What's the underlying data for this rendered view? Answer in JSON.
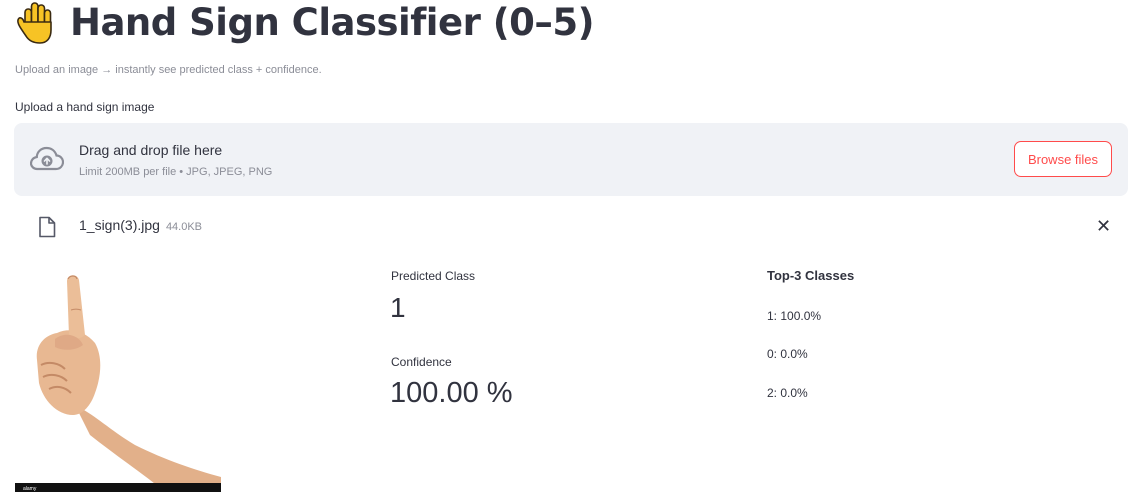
{
  "app": {
    "title": "Hand Sign Classifier (0–5)",
    "title_icon": "raised-hand-emoji",
    "subtitle": "Upload an image → instantly see predicted class + confidence."
  },
  "uploader": {
    "label": "Upload a hand sign image",
    "drop_text": "Drag and drop file here",
    "limit_text": "Limit 200MB per file • JPG, JPEG, PNG",
    "browse_label": "Browse files",
    "accent_color": "#ff4b4b"
  },
  "file": {
    "name": "1_sign(3).jpg",
    "size": "44.0KB",
    "remove_icon": "close-icon"
  },
  "prediction": {
    "class_label": "Predicted Class",
    "class_value": "1",
    "confidence_label": "Confidence",
    "confidence_value": "100.00 %"
  },
  "top3": {
    "title": "Top-3 Classes",
    "items": [
      "1: 100.0%",
      "0: 0.0%",
      "2: 0.0%"
    ]
  }
}
